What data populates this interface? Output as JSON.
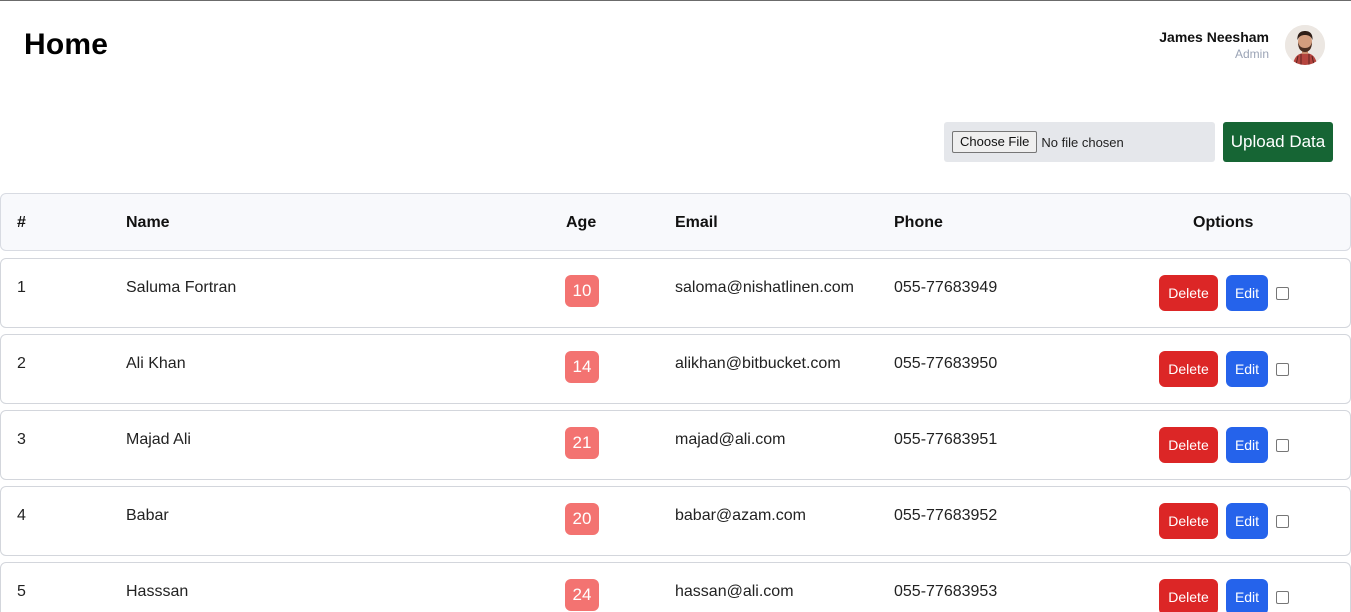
{
  "header": {
    "title": "Home",
    "user": {
      "name": "James Neesham",
      "role": "Admin"
    }
  },
  "upload": {
    "choose_file_label": "Choose File",
    "no_file_text": "No file chosen",
    "upload_label": "Upload Data"
  },
  "table": {
    "columns": [
      "#",
      "Name",
      "Age",
      "Email",
      "Phone",
      "Options"
    ],
    "rows": [
      {
        "num": "1",
        "name": "Saluma Fortran",
        "age": "10",
        "email": "saloma@nishatlinen.com",
        "phone": "055-77683949"
      },
      {
        "num": "2",
        "name": "Ali Khan",
        "age": "14",
        "email": "alikhan@bitbucket.com",
        "phone": "055-77683950"
      },
      {
        "num": "3",
        "name": "Majad Ali",
        "age": "21",
        "email": "majad@ali.com",
        "phone": "055-77683951"
      },
      {
        "num": "4",
        "name": "Babar",
        "age": "20",
        "email": "babar@azam.com",
        "phone": "055-77683952"
      },
      {
        "num": "5",
        "name": "Hasssan",
        "age": "24",
        "email": "hassan@ali.com",
        "phone": "055-77683953"
      }
    ],
    "delete_label": "Delete",
    "edit_label": "Edit"
  },
  "colors": {
    "upload_button": "#166534",
    "delete_button": "#dc2626",
    "edit_button": "#2563eb",
    "age_badge": "#f37371"
  }
}
